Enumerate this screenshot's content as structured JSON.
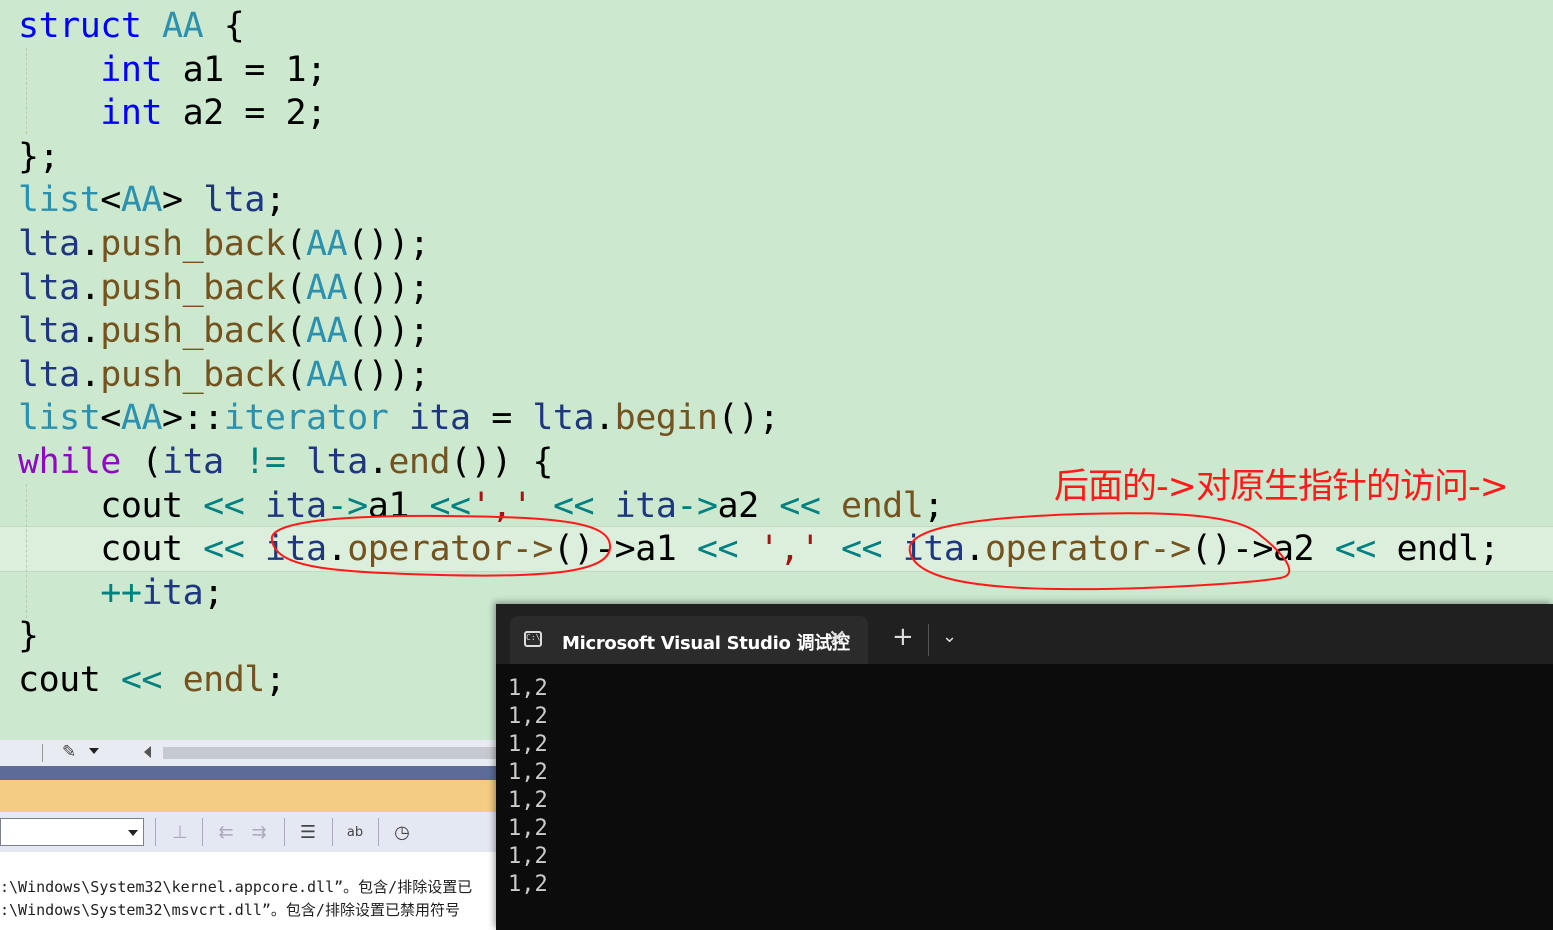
{
  "code_lines": [
    [
      {
        "t": "struct",
        "c": "kw"
      },
      {
        "t": " "
      },
      {
        "t": "AA",
        "c": "type"
      },
      {
        "t": " {"
      }
    ],
    [
      {
        "t": "    "
      },
      {
        "t": "int",
        "c": "kw"
      },
      {
        "t": " a1 = 1;"
      }
    ],
    [
      {
        "t": "    "
      },
      {
        "t": "int",
        "c": "kw"
      },
      {
        "t": " a2 = 2;"
      }
    ],
    [
      {
        "t": "};"
      }
    ],
    [
      {
        "t": "list",
        "c": "type"
      },
      {
        "t": "<"
      },
      {
        "t": "AA",
        "c": "type"
      },
      {
        "t": "> "
      },
      {
        "t": "lta",
        "c": "var"
      },
      {
        "t": ";"
      }
    ],
    [
      {
        "t": "lta",
        "c": "var"
      },
      {
        "t": "."
      },
      {
        "t": "push_back",
        "c": "fn"
      },
      {
        "t": "("
      },
      {
        "t": "AA",
        "c": "type"
      },
      {
        "t": "());"
      }
    ],
    [
      {
        "t": "lta",
        "c": "var"
      },
      {
        "t": "."
      },
      {
        "t": "push_back",
        "c": "fn"
      },
      {
        "t": "("
      },
      {
        "t": "AA",
        "c": "type"
      },
      {
        "t": "());"
      }
    ],
    [
      {
        "t": "lta",
        "c": "var"
      },
      {
        "t": "."
      },
      {
        "t": "push_back",
        "c": "fn"
      },
      {
        "t": "("
      },
      {
        "t": "AA",
        "c": "type"
      },
      {
        "t": "());"
      }
    ],
    [
      {
        "t": "lta",
        "c": "var"
      },
      {
        "t": "."
      },
      {
        "t": "push_back",
        "c": "fn"
      },
      {
        "t": "("
      },
      {
        "t": "AA",
        "c": "type"
      },
      {
        "t": "());"
      }
    ],
    [
      {
        "t": "list",
        "c": "type"
      },
      {
        "t": "<"
      },
      {
        "t": "AA",
        "c": "type"
      },
      {
        "t": ">::"
      },
      {
        "t": "iterator",
        "c": "type"
      },
      {
        "t": " "
      },
      {
        "t": "ita",
        "c": "var"
      },
      {
        "t": " = "
      },
      {
        "t": "lta",
        "c": "var"
      },
      {
        "t": "."
      },
      {
        "t": "begin",
        "c": "fn"
      },
      {
        "t": "();"
      }
    ],
    [
      {
        "t": "while",
        "c": "kw2"
      },
      {
        "t": " ("
      },
      {
        "t": "ita",
        "c": "var"
      },
      {
        "t": " "
      },
      {
        "t": "!=",
        "c": "op"
      },
      {
        "t": " "
      },
      {
        "t": "lta",
        "c": "var"
      },
      {
        "t": "."
      },
      {
        "t": "end",
        "c": "fn"
      },
      {
        "t": "()) {"
      }
    ],
    [
      {
        "t": "    cout "
      },
      {
        "t": "<<",
        "c": "op"
      },
      {
        "t": " "
      },
      {
        "t": "ita",
        "c": "var"
      },
      {
        "t": "->",
        "c": "op"
      },
      {
        "t": "a1 "
      },
      {
        "t": "<<",
        "c": "op"
      },
      {
        "t": "','",
        "c": "str"
      },
      {
        "t": " "
      },
      {
        "t": "<<",
        "c": "op"
      },
      {
        "t": " "
      },
      {
        "t": "ita",
        "c": "var"
      },
      {
        "t": "->",
        "c": "op"
      },
      {
        "t": "a2 "
      },
      {
        "t": "<<",
        "c": "op"
      },
      {
        "t": " "
      },
      {
        "t": "endl",
        "c": "fn"
      },
      {
        "t": ";"
      }
    ],
    [
      {
        "t": "    cout "
      },
      {
        "t": "<<",
        "c": "op"
      },
      {
        "t": " "
      },
      {
        "t": "ita",
        "c": "var"
      },
      {
        "t": "."
      },
      {
        "t": "operator->",
        "c": "fn"
      },
      {
        "t": "()->a1 "
      },
      {
        "t": "<<",
        "c": "op"
      },
      {
        "t": " "
      },
      {
        "t": "','",
        "c": "str"
      },
      {
        "t": " "
      },
      {
        "t": "<<",
        "c": "op"
      },
      {
        "t": " "
      },
      {
        "t": "ita",
        "c": "var"
      },
      {
        "t": "."
      },
      {
        "t": "operator->",
        "c": "fn"
      },
      {
        "t": "()->a2 "
      },
      {
        "t": "<<",
        "c": "op"
      },
      {
        "t": " endl;"
      }
    ],
    [
      {
        "t": "    "
      },
      {
        "t": "++",
        "c": "op"
      },
      {
        "t": "ita",
        "c": "var"
      },
      {
        "t": ";"
      }
    ],
    [
      {
        "t": "}"
      }
    ],
    [
      {
        "t": "cout "
      },
      {
        "t": "<<",
        "c": "op"
      },
      {
        "t": " "
      },
      {
        "t": "endl",
        "c": "fn"
      },
      {
        "t": ";"
      }
    ]
  ],
  "annotation": "后面的->对原生指针的访问->",
  "output_pane": {
    "lines": [
      ":\\Windows\\System32\\kernel.appcore.dll”。包含/排除设置已",
      ":\\Windows\\System32\\msvcrt.dll”。包含/排除设置已禁用符号"
    ]
  },
  "console": {
    "tab_title": "Microsoft Visual Studio 调试控",
    "tab_icon": "terminal-icon",
    "new_tab_glyph": "+",
    "dropdown_glyph": "⌄",
    "output_lines": [
      "1,2",
      "1,2",
      "1,2",
      "1,2",
      "1,2",
      "1,2",
      "1,2",
      "1,2"
    ]
  },
  "colors": {
    "editor_bg": "#cce8cf",
    "annotation": "#ff1a1a",
    "console_bg": "#0c0c0c"
  }
}
